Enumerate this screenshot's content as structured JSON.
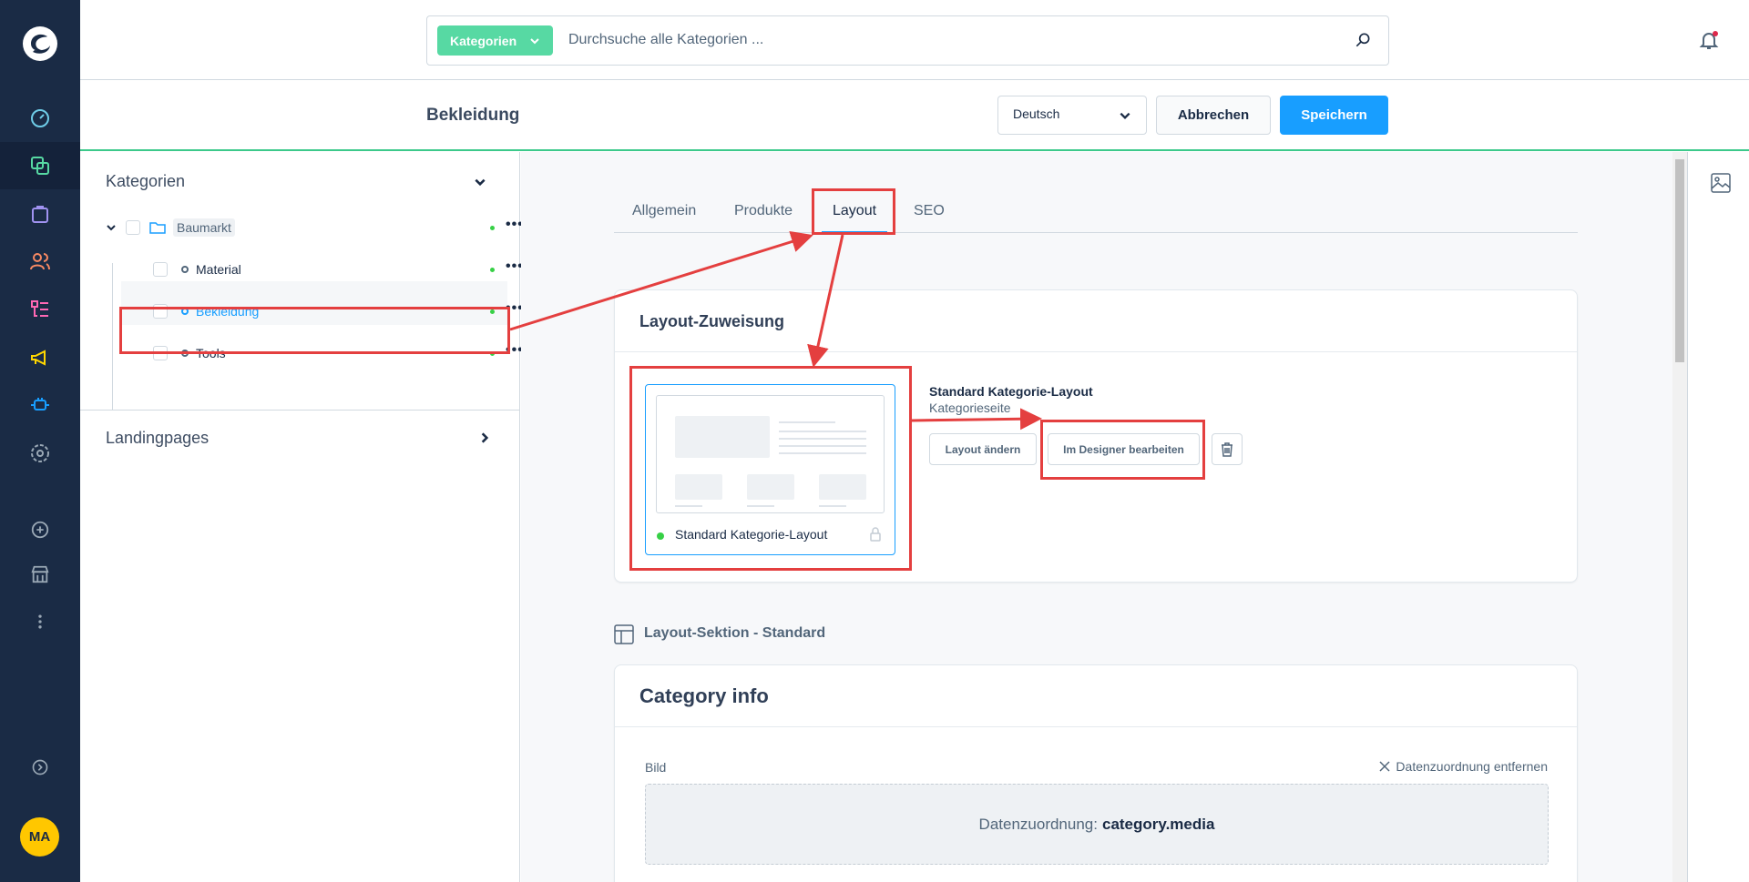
{
  "sidebar": {
    "avatar_initials": "MA",
    "items": [
      {
        "icon": "dashboard-icon"
      },
      {
        "icon": "catalogue-icon"
      },
      {
        "icon": "orders-icon"
      },
      {
        "icon": "customers-icon"
      },
      {
        "icon": "content-icon"
      },
      {
        "icon": "marketing-icon"
      },
      {
        "icon": "extensions-icon"
      },
      {
        "icon": "settings-icon"
      }
    ],
    "colors": {
      "bg": "#1a2b45",
      "accent": "#57d9a3"
    }
  },
  "topbar": {
    "search_type": "Kategorien",
    "search_placeholder": "Durchsuche alle Kategorien ..."
  },
  "smartbar": {
    "title": "Bekleidung",
    "language": "Deutsch",
    "cancel_label": "Abbrechen",
    "save_label": "Speichern"
  },
  "tree": {
    "header": "Kategorien",
    "root": "Baumarkt",
    "children": [
      "Material",
      "Bekleidung",
      "Tools"
    ],
    "landingpages": "Landingpages"
  },
  "tabs": [
    "Allgemein",
    "Produkte",
    "Layout",
    "SEO"
  ],
  "layout_card": {
    "title": "Layout-Zuweisung",
    "preview_name": "Standard Kategorie-Layout",
    "layout_name": "Standard Kategorie-Layout",
    "layout_type": "Kategorieseite",
    "change_label": "Layout ändern",
    "designer_label": "Im Designer bearbeiten"
  },
  "section": {
    "title": "Layout-Sektion - Standard"
  },
  "category_info": {
    "title": "Category info",
    "field_label": "Bild",
    "remove_mapping": "Datenzuordnung entfernen",
    "mapping_prefix": "Datenzuordnung:",
    "mapping_value": "category.media"
  }
}
